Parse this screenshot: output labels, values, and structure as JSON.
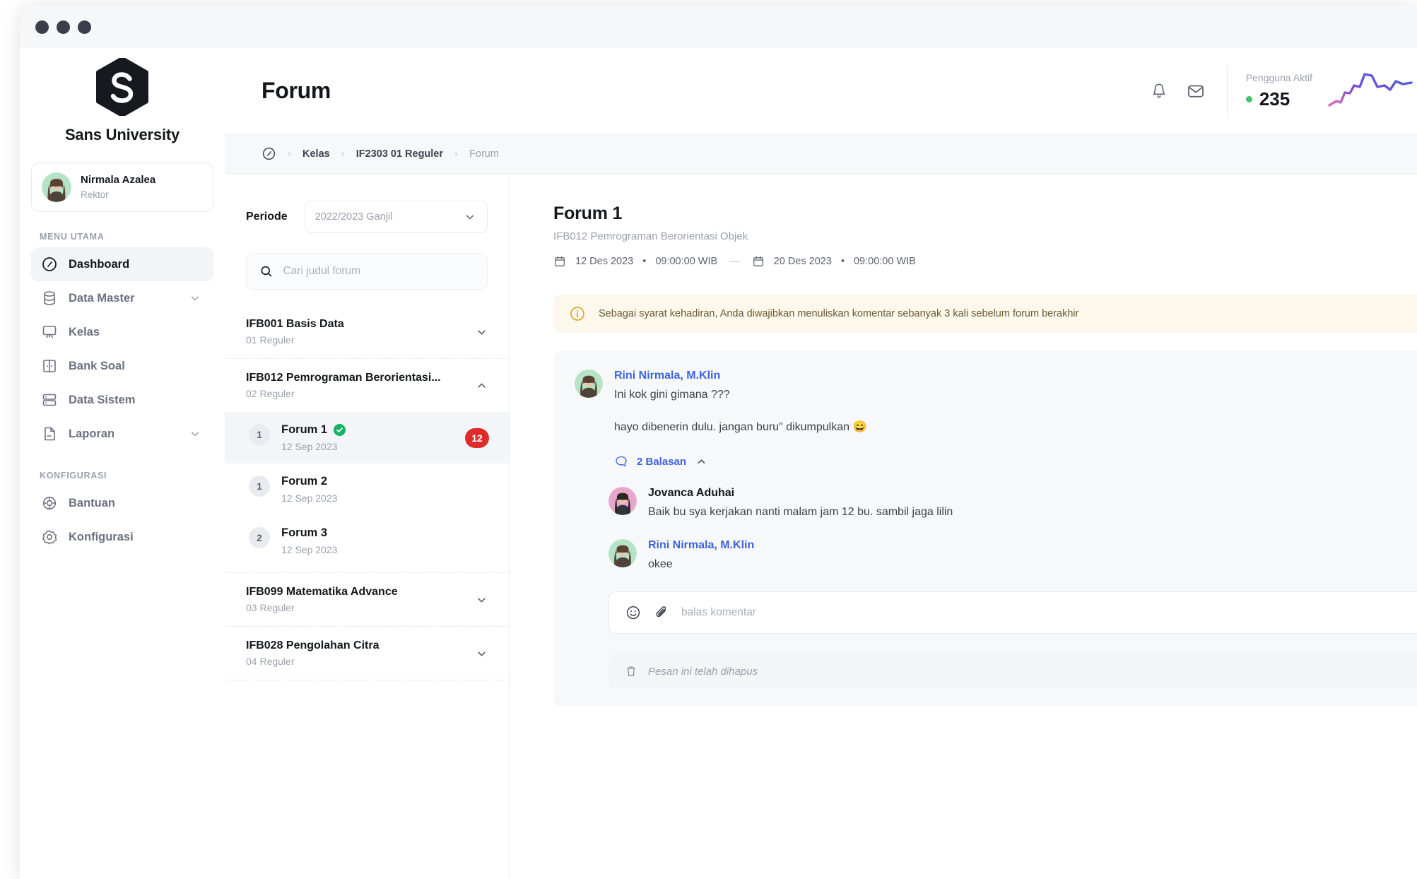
{
  "window": {
    "dots": 3
  },
  "sidebar": {
    "brand": {
      "name": "Sans University",
      "logo_letter": "S",
      "logo_color": "#17191f"
    },
    "user": {
      "name": "Nirmala Azalea",
      "role": "Rektor",
      "avatar": "user-avatar"
    },
    "sections": [
      {
        "label": "MENU UTAMA",
        "items": [
          {
            "label": "Dashboard",
            "icon": "dashboard-icon",
            "active": true,
            "expandable": false
          },
          {
            "label": "Data Master",
            "icon": "database-icon",
            "active": false,
            "expandable": true
          },
          {
            "label": "Kelas",
            "icon": "classroom-icon",
            "active": false,
            "expandable": false
          },
          {
            "label": "Bank Soal",
            "icon": "question-bank-icon",
            "active": false,
            "expandable": false
          },
          {
            "label": "Data Sistem",
            "icon": "server-icon",
            "active": false,
            "expandable": false
          },
          {
            "label": "Laporan",
            "icon": "report-icon",
            "active": false,
            "expandable": true
          }
        ]
      },
      {
        "label": "KONFIGURASI",
        "items": [
          {
            "label": "Bantuan",
            "icon": "help-icon",
            "active": false,
            "expandable": false
          },
          {
            "label": "Konfigurasi",
            "icon": "gear-icon",
            "active": false,
            "expandable": false
          }
        ]
      }
    ]
  },
  "header": {
    "title": "Forum",
    "bell_icon": "bell-icon",
    "inbox_icon": "inbox-icon",
    "active_users": {
      "label": "Pengguna Aktif",
      "count": "235",
      "status_color": "#45c16a",
      "sparkline": "activity-sparkline"
    }
  },
  "breadcrumb": {
    "home_icon": "dashboard-icon",
    "items": [
      {
        "label": "Kelas",
        "current": false
      },
      {
        "label": "IF2303 01 Reguler",
        "current": false
      },
      {
        "label": "Forum",
        "current": true
      }
    ],
    "separator": "›"
  },
  "list_panel": {
    "periode": {
      "label": "Periode",
      "value": "2022/2023 Ganjil",
      "chevron": "chevron-down-icon"
    },
    "search": {
      "placeholder": "Cari judul forum",
      "value": "",
      "icon": "search-icon"
    },
    "courses": [
      {
        "code_title": "IFB001 Basis Data",
        "sub": "01 Reguler",
        "expanded": false
      },
      {
        "code_title": "IFB012 Pemrograman Berorientasi...",
        "sub": "02 Reguler",
        "expanded": true
      },
      {
        "code_title": "IFB099 Matematika Advance",
        "sub": "03 Reguler",
        "expanded": false
      },
      {
        "code_title": "IFB028 Pengolahan Citra",
        "sub": "04 Reguler",
        "expanded": false
      }
    ],
    "forums": [
      {
        "num": "1",
        "title": "Forum 1",
        "date": "12 Sep 2023",
        "selected": true,
        "verified": true,
        "badge": "12"
      },
      {
        "num": "1",
        "title": "Forum 2",
        "date": "12 Sep 2023",
        "selected": false,
        "verified": false,
        "badge": ""
      },
      {
        "num": "2",
        "title": "Forum 3",
        "date": "12 Sep 2023",
        "selected": false,
        "verified": false,
        "badge": ""
      }
    ]
  },
  "detail": {
    "title": "Forum 1",
    "subtitle": "IFB012 Pemrograman Berorientasi Objek",
    "start": {
      "date": "12 Des 2023",
      "bullet": "•",
      "time": "09:00:00 WIB",
      "icon": "calendar-icon"
    },
    "end": {
      "date": "20 Des 2023",
      "bullet": "•",
      "time": "09:00:00 WIB",
      "icon": "calendar-icon"
    },
    "range_dash": "—",
    "alert": {
      "icon": "info-icon",
      "text": "Sebagai syarat kehadiran, Anda diwajibkan menuliskan komentar sebanyak 3 kali sebelum forum berakhir",
      "bg": "#fdf8ec",
      "accent": "#e0a62a"
    },
    "comment": {
      "author": "Rini Nirmala, M.Klin",
      "avatar": "teacher-avatar",
      "line1": "Ini kok gini gimana ???",
      "line2": "hayo dibenerin dulu. jangan buru\" dikumpulkan 😄",
      "replies_label": "2 Balasan",
      "replies_icon": "comment-icon",
      "collapse_icon": "chevron-up-icon"
    },
    "replies": [
      {
        "author": "Jovanca Aduhai",
        "avatar": "student-avatar",
        "link": false,
        "text": "Baik bu sya kerjakan nanti malam jam 12 bu. sambil jaga lilin"
      },
      {
        "author": "Rini Nirmala, M.Klin",
        "avatar": "teacher-avatar",
        "link": true,
        "text": "okee"
      }
    ],
    "reply_input": {
      "placeholder": "balas komentar",
      "value": "",
      "emoji_icon": "emoji-icon",
      "attach_icon": "paperclip-icon",
      "send_icon": "send-icon"
    },
    "deleted_message": {
      "icon": "trash-icon",
      "text": "Pesan ini telah dihapus"
    }
  }
}
